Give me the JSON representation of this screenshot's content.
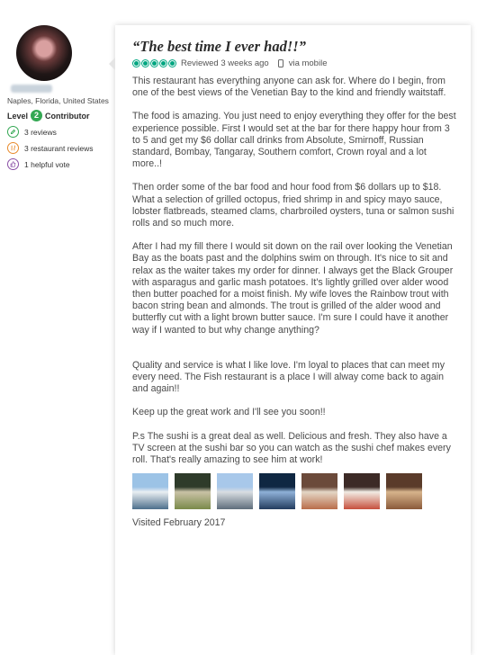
{
  "member": {
    "username": "username",
    "location": "Naples, Florida, United States",
    "level_label": "Level",
    "level_number": "2",
    "level_title": "Contributor",
    "stats": [
      {
        "icon": "pencil-icon",
        "text": "3 reviews"
      },
      {
        "icon": "fork-knife-icon",
        "text": "3 restaurant reviews"
      },
      {
        "icon": "thumbs-up-icon",
        "text": "1 helpful vote"
      }
    ]
  },
  "review": {
    "title": "“The best time I ever had!!”",
    "rating_bubbles": 5,
    "reviewed": "Reviewed 3 weeks ago",
    "via": "via mobile",
    "paragraphs": [
      "This restaurant has everything anyone can ask for. Where do I begin, from one of the best views of the Venetian Bay to the kind and friendly waitstaff.",
      "The food is amazing. You just need to enjoy everything they offer for the best experience possible. First I would set at the bar for there happy hour from 3 to 5 and get my $6 dollar call drinks from Absolute, Smirnoff, Russian standard, Bombay, Tangaray, Southern comfort, Crown royal and a lot more..!",
      "Then order some of the bar food and hour food from $6 dollars up to $18. What a selection of grilled octopus, fried shrimp in and spicy mayo sauce, lobster flatbreads, steamed clams, charbroiled oysters, tuna or salmon sushi rolls and so much more.",
      "After I had my fill there I would sit down on the rail over looking the Venetian Bay as the boats past and the dolphins swim on through. It's nice to sit and relax as the waiter takes my order for dinner. I always get the Black Grouper with asparagus and garlic mash potatoes. It's lightly grilled over alder wood then butter poached for a moist finish. My wife loves the Rainbow trout with bacon string bean and almonds. The trout is grilled of the alder wood and butterfly cut with a light brown butter sauce. I'm sure I could have it another way if I wanted to but why change anything?",
      "Quality and service is what I like love. I'm loyal to places that can meet my every need. The Fish restaurant is a place I will alway come back to again and again!!",
      "Keep up the great work and I'll see you soon!!",
      "P.s The sushi is a great deal as well. Delicious and fresh. They also have a TV screen at the sushi bar so you can watch as the sushi chef makes every roll. That's really amazing to see him at work!"
    ],
    "photos": [
      {
        "name": "marina-photo",
        "colors": [
          "#9cc3e6",
          "#e9eef2",
          "#4d6f8c"
        ]
      },
      {
        "name": "octopus-dish-photo",
        "colors": [
          "#2e3b2a",
          "#c9c2a6",
          "#7a8a4a"
        ]
      },
      {
        "name": "waterfront-photo",
        "colors": [
          "#a8c8ea",
          "#d8dde2",
          "#5e6e7c"
        ]
      },
      {
        "name": "night-bay-photo",
        "colors": [
          "#0f2742",
          "#8fb1d8",
          "#233c5e"
        ]
      },
      {
        "name": "sushi-plate-photo",
        "colors": [
          "#6b4a3a",
          "#e4d7c6",
          "#b96d4a"
        ]
      },
      {
        "name": "dessert-photo",
        "colors": [
          "#3c2a26",
          "#f2ece4",
          "#c6503d"
        ]
      },
      {
        "name": "entree-photo",
        "colors": [
          "#5a3b2a",
          "#d7b48c",
          "#8a5a3a"
        ]
      }
    ],
    "visited": "Visited February 2017"
  },
  "colors": {
    "bubble": "#00a680",
    "level_badge": "#34a853"
  }
}
